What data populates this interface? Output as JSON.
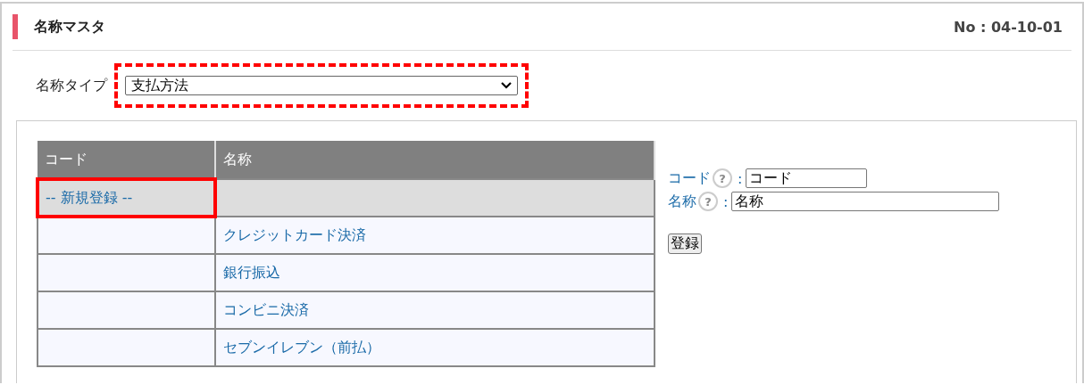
{
  "header": {
    "title": "名称マスタ",
    "screen_no": "No : 04-10-01"
  },
  "name_type": {
    "label": "名称タイプ",
    "value": "支払方法",
    "highlighted": true
  },
  "table": {
    "columns": [
      "コード",
      "名称"
    ],
    "rows": [
      {
        "code": "-- 新規登録 --",
        "selected": true,
        "highlighted": true
      },
      {
        "name": "クレジットカード決済",
        "selected": false,
        "highlighted": false
      },
      {
        "name": "銀行振込",
        "selected": false,
        "highlighted": false
      },
      {
        "name": "コンビニ決済",
        "selected": false,
        "highlighted": false
      },
      {
        "name": "セブンイレブン（前払）",
        "selected": false,
        "highlighted": false
      }
    ]
  },
  "form": {
    "fields": [
      {
        "label": "コード",
        "help": "?",
        "separator": ":",
        "value": "コード",
        "wide": false
      },
      {
        "label": "名称",
        "help": "?",
        "separator": ":",
        "value": "名称",
        "wide": true
      }
    ],
    "submit": "登録"
  }
}
